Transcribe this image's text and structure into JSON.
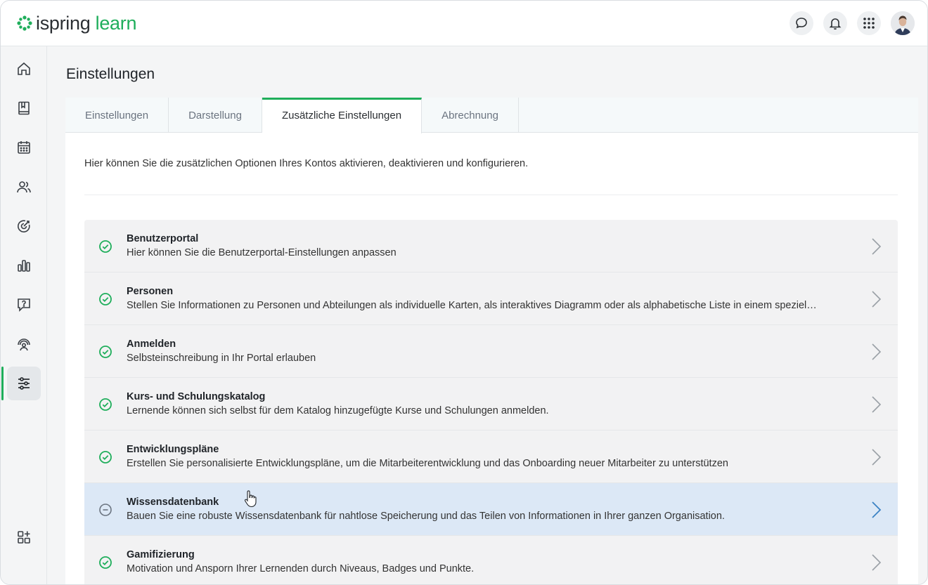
{
  "header": {
    "logo_text_main": "ispring",
    "logo_text_accent": "learn",
    "brand_color": "#1fae5b"
  },
  "sidebar": {
    "items": [
      {
        "name": "home",
        "icon": "home-icon",
        "active": false
      },
      {
        "name": "library",
        "icon": "book-icon",
        "active": false
      },
      {
        "name": "calendar",
        "icon": "calendar-icon",
        "active": false
      },
      {
        "name": "users",
        "icon": "users-icon",
        "active": false
      },
      {
        "name": "goals",
        "icon": "target-icon",
        "active": false
      },
      {
        "name": "reports",
        "icon": "bar-chart-icon",
        "active": false
      },
      {
        "name": "questions",
        "icon": "question-chat-icon",
        "active": false
      },
      {
        "name": "support",
        "icon": "headset-icon",
        "active": false
      },
      {
        "name": "settings",
        "icon": "sliders-icon",
        "active": true
      }
    ],
    "bottom_item": {
      "name": "add-apps",
      "icon": "apps-add-icon"
    }
  },
  "page": {
    "title": "Einstellungen",
    "tabs": [
      {
        "label": "Einstellungen",
        "active": false
      },
      {
        "label": "Darstellung",
        "active": false
      },
      {
        "label": "Zusätzliche Einstellungen",
        "active": true
      },
      {
        "label": "Abrechnung",
        "active": false
      }
    ],
    "intro": "Hier können Sie die zusätzlichen Optionen Ihres Kontos aktivieren, deaktivieren und konfigurieren.",
    "options": [
      {
        "title": "Benutzerportal",
        "desc": "Hier können Sie die Benutzerportal-Einstellungen anpassen",
        "enabled": true
      },
      {
        "title": "Personen",
        "desc": "Stellen Sie Informationen zu Personen und Abteilungen als individuelle Karten, als interaktives Diagramm oder als alphabetische Liste in einem speziel…",
        "enabled": true
      },
      {
        "title": "Anmelden",
        "desc": "Selbsteinschreibung in Ihr Portal erlauben",
        "enabled": true
      },
      {
        "title": "Kurs- und Schulungskatalog",
        "desc": "Lernende können sich selbst für dem Katalog hinzugefügte Kurse und Schulungen anmelden.",
        "enabled": true
      },
      {
        "title": "Entwicklungspläne",
        "desc": "Erstellen Sie personalisierte Entwicklungspläne, um die Mitarbeiterentwicklung und das Onboarding neuer Mitarbeiter zu unterstützen",
        "enabled": true
      },
      {
        "title": "Wissensdatenbank",
        "desc": "Bauen Sie eine robuste Wissensdatenbank für nahtlose Speicherung und das Teilen von Informationen in Ihrer ganzen Organisation.",
        "enabled": false,
        "hovered": true
      },
      {
        "title": "Gamifizierung",
        "desc": "Motivation und Ansporn Ihrer Lernenden durch Niveaus, Badges und Punkte.",
        "enabled": true
      }
    ]
  }
}
